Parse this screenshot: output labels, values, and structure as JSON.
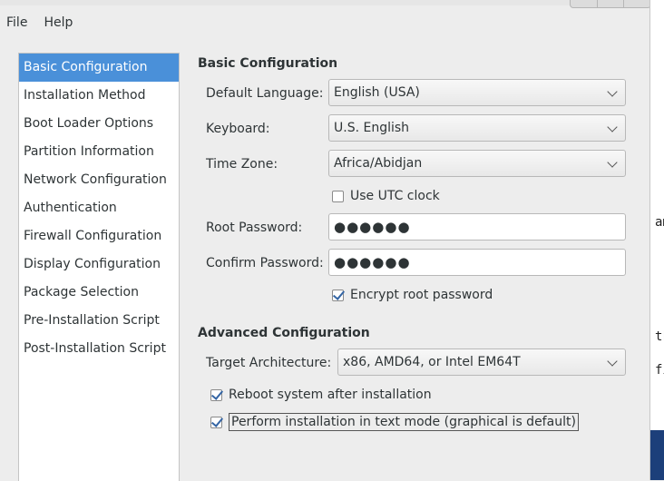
{
  "menubar": {
    "file": "File",
    "help": "Help"
  },
  "sidebar": {
    "items": [
      {
        "label": "Basic Configuration"
      },
      {
        "label": "Installation Method"
      },
      {
        "label": "Boot Loader Options"
      },
      {
        "label": "Partition Information"
      },
      {
        "label": "Network Configuration"
      },
      {
        "label": "Authentication"
      },
      {
        "label": "Firewall Configuration"
      },
      {
        "label": "Display Configuration"
      },
      {
        "label": "Package Selection"
      },
      {
        "label": "Pre-Installation Script"
      },
      {
        "label": "Post-Installation Script"
      }
    ],
    "selected_index": 0
  },
  "basic": {
    "heading": "Basic Configuration",
    "language_label": "Default Language:",
    "language_value": "English (USA)",
    "keyboard_label": "Keyboard:",
    "keyboard_value": "U.S. English",
    "timezone_label": "Time Zone:",
    "timezone_value": "Africa/Abidjan",
    "utc_label": "Use UTC clock",
    "utc_checked": false,
    "root_password_label": "Root Password:",
    "root_password_value": "●●●●●●",
    "confirm_password_label": "Confirm Password:",
    "confirm_password_value": "●●●●●●",
    "encrypt_label": "Encrypt root password",
    "encrypt_checked": true
  },
  "advanced": {
    "heading": "Advanced Configuration",
    "arch_label": "Target Architecture:",
    "arch_value": "x86, AMD64, or Intel EM64T",
    "reboot_label": "Reboot system after installation",
    "reboot_checked": true,
    "textmode_label": "Perform installation in text mode (graphical is default)",
    "textmode_checked": true
  },
  "background_window": {
    "line1": "am",
    "line2": "tk",
    "line3": "fi"
  },
  "colors": {
    "selection": "#4a90d9",
    "check": "#3465a4",
    "window_bg": "#ededed"
  }
}
